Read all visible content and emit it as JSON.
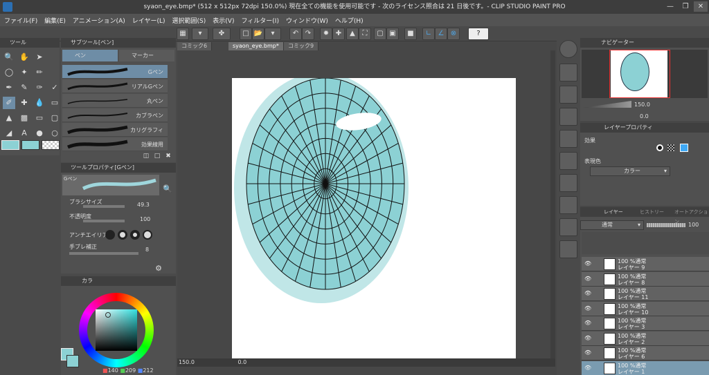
{
  "window": {
    "title": "syaon_eye.bmp* (512 x 512px 72dpi 150.0%)  現在全ての機能を使用可能です - 次のライセンス照合は 21 日後です。- CLIP STUDIO PAINT PRO"
  },
  "menu": [
    "ファイル(F)",
    "編集(E)",
    "アニメーション(A)",
    "レイヤー(L)",
    "選択範囲(S)",
    "表示(V)",
    "フィルター(I)",
    "ウィンドウ(W)",
    "ヘルプ(H)"
  ],
  "doc_tabs": [
    "コミック6",
    "syaon_eye.bmp*",
    "コミック9"
  ],
  "tool_panel": {
    "title": "ツール"
  },
  "subtool_panel": {
    "title": "サブツール[ペン]",
    "tabs": [
      "ペン",
      "マーカー"
    ],
    "brushes": [
      "Gペン",
      "リアルGペン",
      "丸ペン",
      "カブラペン",
      "カリグラフィ",
      "効果線用"
    ]
  },
  "tool_property": {
    "title": "ツールプロパティ[Gペン]",
    "preset_name": "Gペン",
    "brush_size_label": "ブラシサイズ",
    "brush_size": "49.3",
    "opacity_label": "不透明度",
    "opacity": "100",
    "antialias_label": "アンチエイリアス",
    "stabilization_label": "手ブレ補正",
    "stabilization": "8"
  },
  "color_panel": {
    "title": "カラ",
    "r": "140",
    "g": "209",
    "b": "212",
    "main_color": "#8cd1d4"
  },
  "canvas": {
    "zoom": "150.0",
    "angle": "0.0",
    "fill_color": "#8cd1d4"
  },
  "navigator": {
    "title": "ナビゲーター",
    "zoom": "150.0",
    "angle": "0.0"
  },
  "layer_property": {
    "title": "レイヤープロパティ",
    "effect_label": "効果",
    "expression_label": "表現色",
    "expression_value": "カラー"
  },
  "layer_panel": {
    "tabs": [
      "レイヤー",
      "ヒストリー",
      "オートアクション"
    ],
    "blend_mode": "通常",
    "opacity": "100",
    "layers": [
      {
        "line1": "100 %通常",
        "line2": "レイヤー 9"
      },
      {
        "line1": "100 %通常",
        "line2": "レイヤー 8"
      },
      {
        "line1": "100 %通常",
        "line2": "レイヤー 11"
      },
      {
        "line1": "100 %通常",
        "line2": "レイヤー 10"
      },
      {
        "line1": "100 %通常",
        "line2": "レイヤー 3"
      },
      {
        "line1": "100 %通常",
        "line2": "レイヤー 2"
      },
      {
        "line1": "100 %通常",
        "line2": "レイヤー 6"
      },
      {
        "line1": "100 %通常",
        "line2": "レイヤー 1"
      }
    ]
  }
}
